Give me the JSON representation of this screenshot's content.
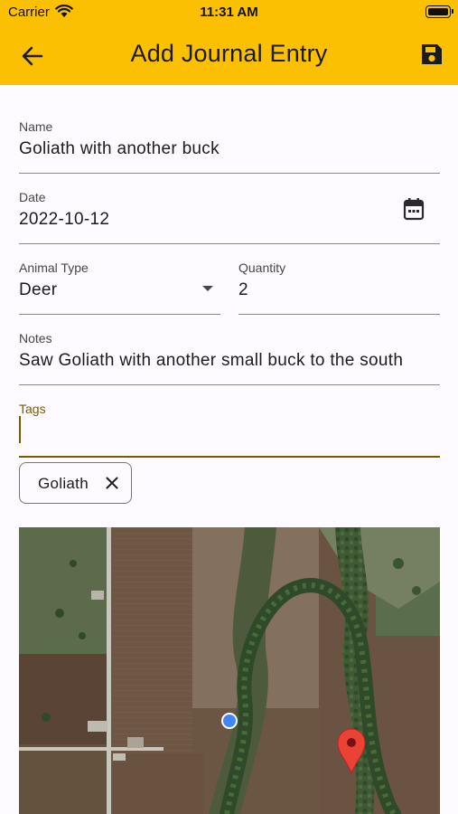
{
  "status_bar": {
    "carrier": "Carrier",
    "time": "11:31 AM"
  },
  "app_bar": {
    "title": "Add Journal Entry",
    "back_icon": "arrow-left-icon",
    "save_icon": "floppy-disk-icon",
    "background": "#fcc002"
  },
  "form": {
    "name": {
      "label": "Name",
      "value": "Goliath with another buck"
    },
    "date": {
      "label": "Date",
      "value": "2022-10-12",
      "icon": "calendar-icon"
    },
    "animal_type": {
      "label": "Animal Type",
      "value": "Deer"
    },
    "quantity": {
      "label": "Quantity",
      "value": "2"
    },
    "notes": {
      "label": "Notes",
      "value": "Saw Goliath with another small buck to the south"
    },
    "tags": {
      "label": "Tags",
      "value": "",
      "accent": "#7a5a00"
    }
  },
  "chips": [
    {
      "label": "Goliath",
      "icon": "close-icon"
    }
  ],
  "map": {
    "type": "satellite",
    "markers": [
      "current-location-dot",
      "red-pin"
    ]
  }
}
